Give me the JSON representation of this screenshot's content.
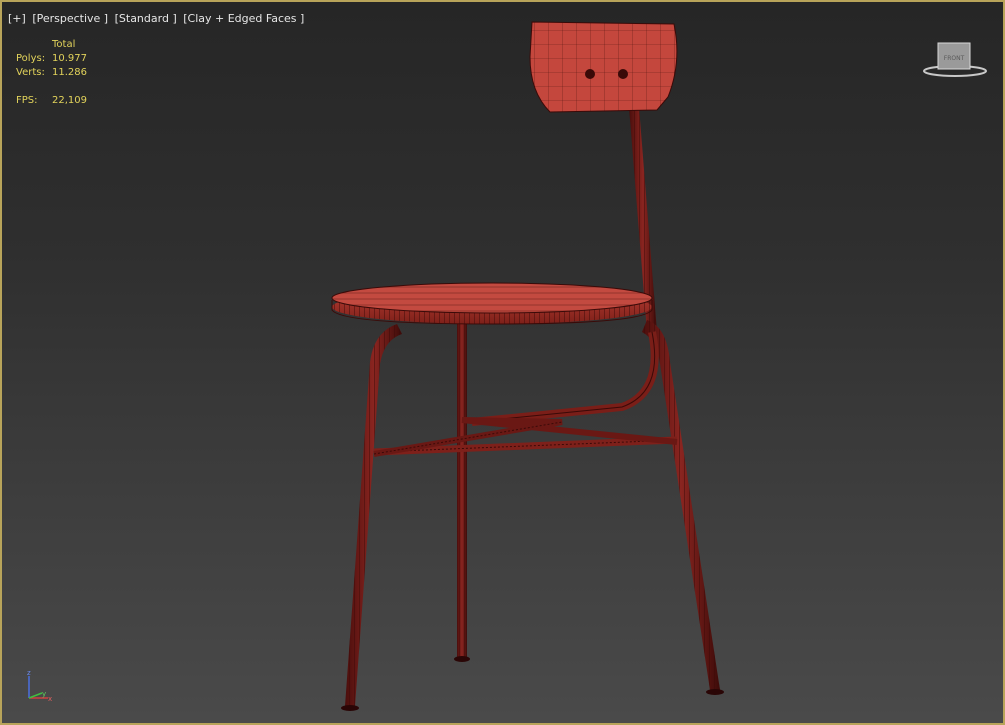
{
  "viewport": {
    "label_parts": [
      "[+]",
      "[Perspective ]",
      "[Standard ]",
      "[Clay + Edged Faces ]"
    ]
  },
  "stats": {
    "header": "Total",
    "polys_label": "Polys:",
    "polys_value": "10.977",
    "verts_label": "Verts:",
    "verts_value": "11.286",
    "fps_label": "FPS:",
    "fps_value": "22,109"
  },
  "viewcube": {
    "face_label": "FRONT"
  },
  "axis": {
    "x_label": "x",
    "y_label": "y",
    "z_label": "z"
  },
  "colors": {
    "border": "#b8a45a",
    "stats_text": "#e2d35b",
    "clay_light": "#c0433a",
    "clay_dark": "#5a1210",
    "wire": "#3a0a08"
  },
  "scene": {
    "object": "chair"
  }
}
